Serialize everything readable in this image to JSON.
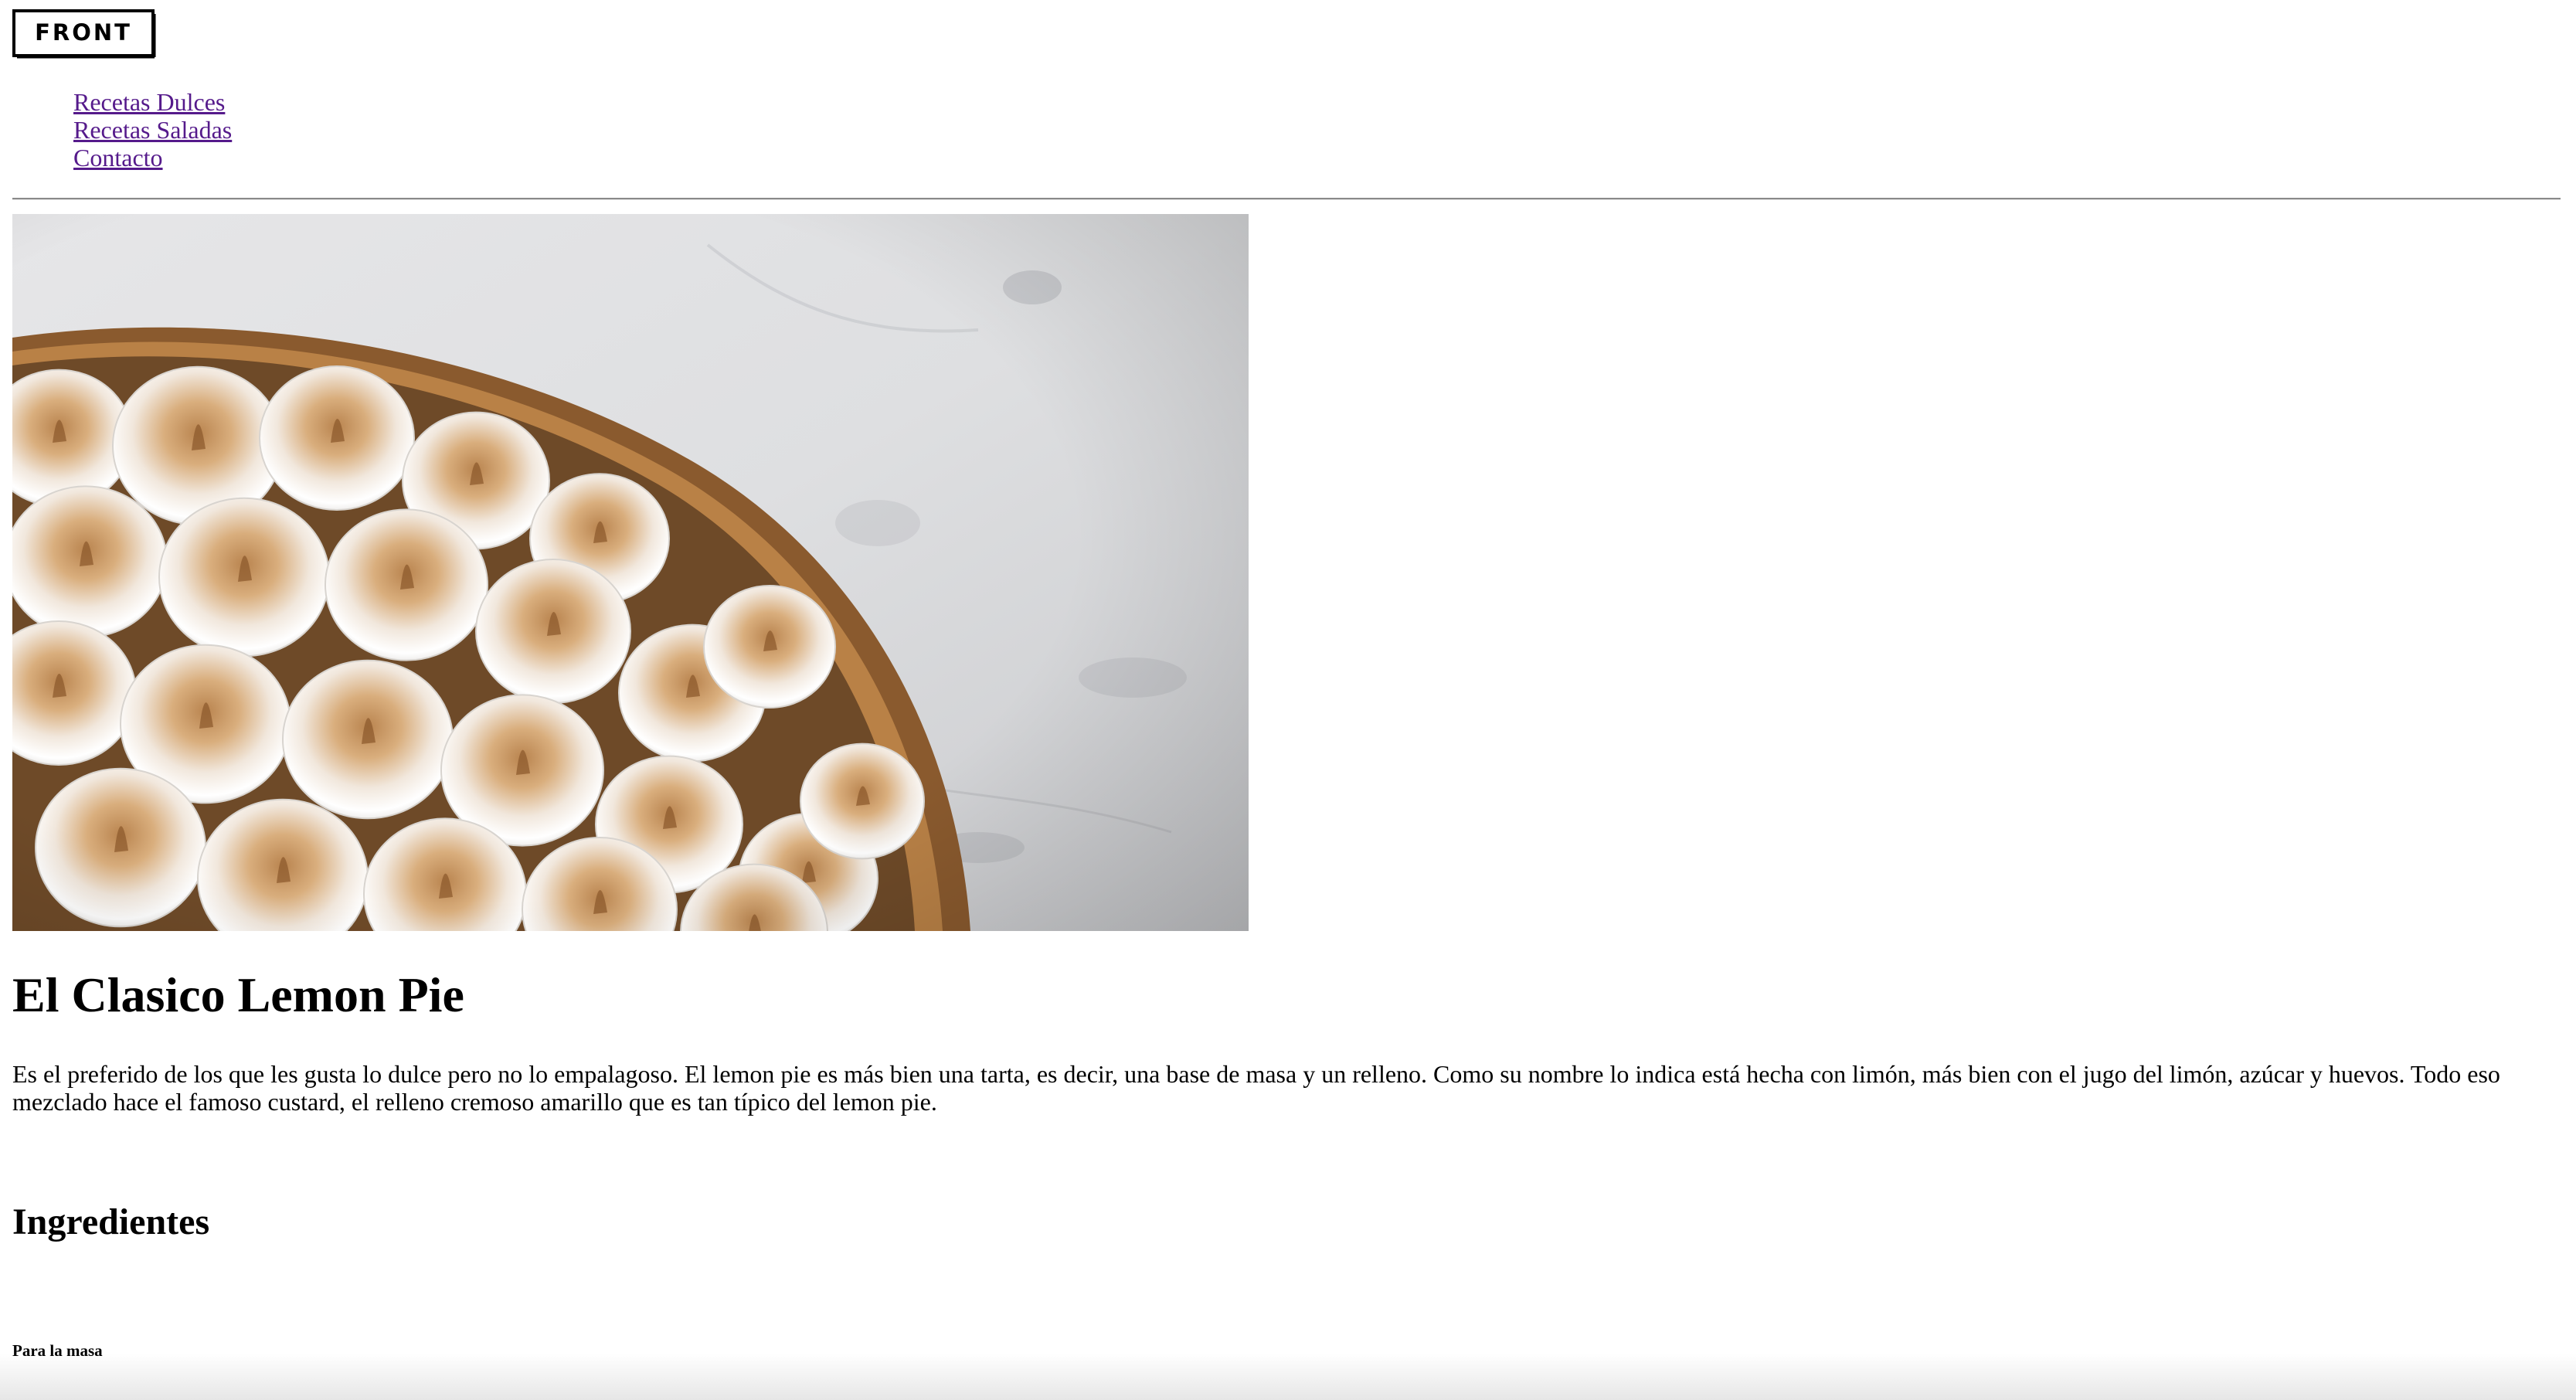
{
  "header": {
    "logo_text": "FRONT",
    "logo_icon": "front-logo"
  },
  "nav": {
    "items": [
      {
        "label": "Recetas Dulces"
      },
      {
        "label": "Recetas Saladas"
      },
      {
        "label": "Contacto"
      }
    ]
  },
  "hero": {
    "image": "lemon-pie-photo"
  },
  "article": {
    "title": "El Clasico Lemon Pie",
    "intro": "Es el preferido de los que les gusta lo dulce pero no lo empalagoso. El lemon pie es más bien una tarta, es decir, una base de masa y un relleno. Como su nombre lo indica está hecha con limón, más bien con el jugo del limón, azúcar y huevos. Todo eso mezclado hace el famoso custard, el relleno cremoso amarillo que es tan típico del lemon pie.",
    "ingredients_heading": "Ingredientes",
    "dough_heading": "Para la masa"
  },
  "colors": {
    "link_visited": "#551a8b",
    "text": "#000000",
    "background": "#ffffff"
  }
}
